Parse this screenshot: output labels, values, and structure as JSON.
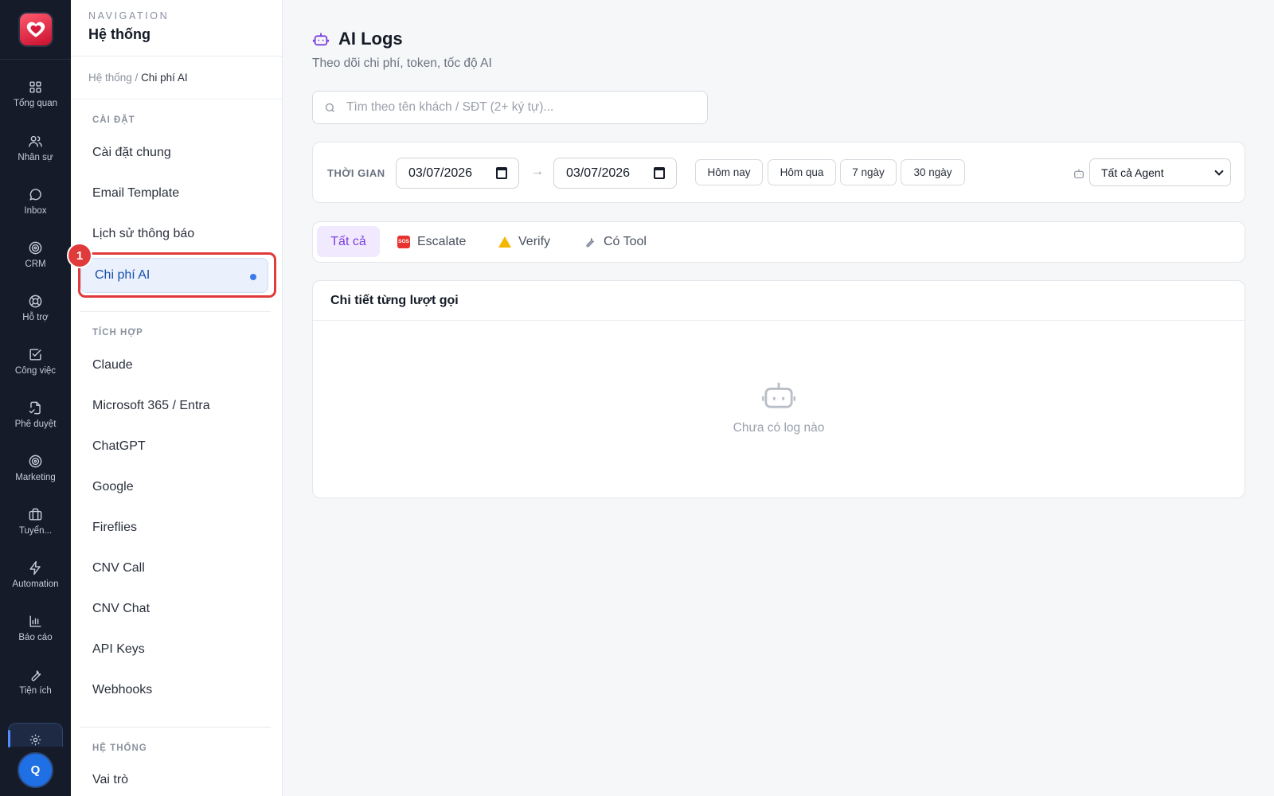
{
  "rail": {
    "items": [
      {
        "label": "Tổng quan",
        "icon": "grid-icon"
      },
      {
        "label": "Nhân sự",
        "icon": "users-icon"
      },
      {
        "label": "Inbox",
        "icon": "chat-icon"
      },
      {
        "label": "CRM",
        "icon": "target-icon"
      },
      {
        "label": "Hỗ trợ",
        "icon": "lifebuoy-icon"
      },
      {
        "label": "Công việc",
        "icon": "checkbox-icon"
      },
      {
        "label": "Phê duyệt",
        "icon": "file-check-icon"
      },
      {
        "label": "Marketing",
        "icon": "target-icon"
      },
      {
        "label": "Tuyển...",
        "icon": "briefcase-icon"
      },
      {
        "label": "Automation",
        "icon": "bolt-icon"
      },
      {
        "label": "Báo cáo",
        "icon": "bar-chart-icon"
      },
      {
        "label": "Tiện ích",
        "icon": "wrench-icon"
      }
    ],
    "avatar_initial": "Q"
  },
  "subnav": {
    "kicker": "NAVIGATION",
    "title": "Hệ thống",
    "breadcrumb_root": "Hệ thống",
    "breadcrumb_sep": " / ",
    "breadcrumb_current": "Chi phí AI",
    "groups": {
      "settings": "CÀI ĐẶT",
      "integrations": "TÍCH HỢP",
      "system": "HỆ THỐNG"
    },
    "settings_items": [
      "Cài đặt chung",
      "Email Template",
      "Lịch sử thông báo",
      "Chi phí AI"
    ],
    "integration_items": [
      "Claude",
      "Microsoft 365 / Entra",
      "ChatGPT",
      "Google",
      "Fireflies",
      "CNV Call",
      "CNV Chat",
      "API Keys",
      "Webhooks"
    ],
    "system_items": [
      "Vai trò"
    ],
    "annotation_number": "1"
  },
  "main": {
    "title": "AI Logs",
    "subtitle": "Theo dõi chi phí, token, tốc độ AI",
    "search_placeholder": "Tìm theo tên khách / SĐT (2+ ký tự)...",
    "filters": {
      "time_label": "THỜI GIAN",
      "date_from": "03/07/2026",
      "date_to": "03/07/2026",
      "arrow": "→",
      "quick": [
        "Hôm nay",
        "Hôm qua",
        "7 ngày",
        "30 ngày"
      ],
      "agent_select": "Tất cả Agent"
    },
    "tabs": [
      {
        "label": "Tất cả",
        "active": true
      },
      {
        "label": "Escalate",
        "icon": "sos-icon"
      },
      {
        "label": "Verify",
        "icon": "warning-icon"
      },
      {
        "label": "Có Tool",
        "icon": "wrench-icon"
      }
    ],
    "table": {
      "title": "Chi tiết từng lượt gọi",
      "empty_message": "Chưa có log nào"
    }
  },
  "colors": {
    "accent": "#7b3fe0",
    "rail_bg": "#151b28",
    "highlight": "#e03a3a",
    "active_nav": "#3b7ae8"
  }
}
